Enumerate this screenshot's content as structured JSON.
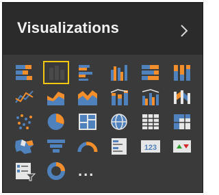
{
  "pane": {
    "title": "Visualizations",
    "more_label": "..."
  },
  "icons": [
    {
      "name": "stacked-bar-chart-icon"
    },
    {
      "name": "stacked-column-chart-icon",
      "selected": true
    },
    {
      "name": "clustered-bar-chart-icon"
    },
    {
      "name": "clustered-column-chart-icon"
    },
    {
      "name": "100-percent-stacked-bar-chart-icon"
    },
    {
      "name": "100-percent-stacked-column-chart-icon"
    },
    {
      "name": "line-chart-icon"
    },
    {
      "name": "area-chart-icon"
    },
    {
      "name": "stacked-area-chart-icon"
    },
    {
      "name": "line-and-stacked-column-chart-icon"
    },
    {
      "name": "line-and-clustered-column-chart-icon"
    },
    {
      "name": "ribbon-chart-icon"
    },
    {
      "name": "scatter-chart-icon"
    },
    {
      "name": "pie-chart-icon"
    },
    {
      "name": "treemap-icon"
    },
    {
      "name": "map-icon"
    },
    {
      "name": "table-icon"
    },
    {
      "name": "matrix-icon"
    },
    {
      "name": "filled-map-icon"
    },
    {
      "name": "funnel-icon"
    },
    {
      "name": "gauge-icon"
    },
    {
      "name": "multi-row-card-icon"
    },
    {
      "name": "card-icon",
      "text": "123"
    },
    {
      "name": "kpi-icon"
    },
    {
      "name": "slicer-icon"
    },
    {
      "name": "donut-chart-icon"
    }
  ],
  "colors": {
    "pane_bg": "#3a3a3a",
    "header_bg": "#2b2b2b",
    "blue": "#4f81bd",
    "orange": "#f28e2b",
    "selection": "#f2c811"
  }
}
